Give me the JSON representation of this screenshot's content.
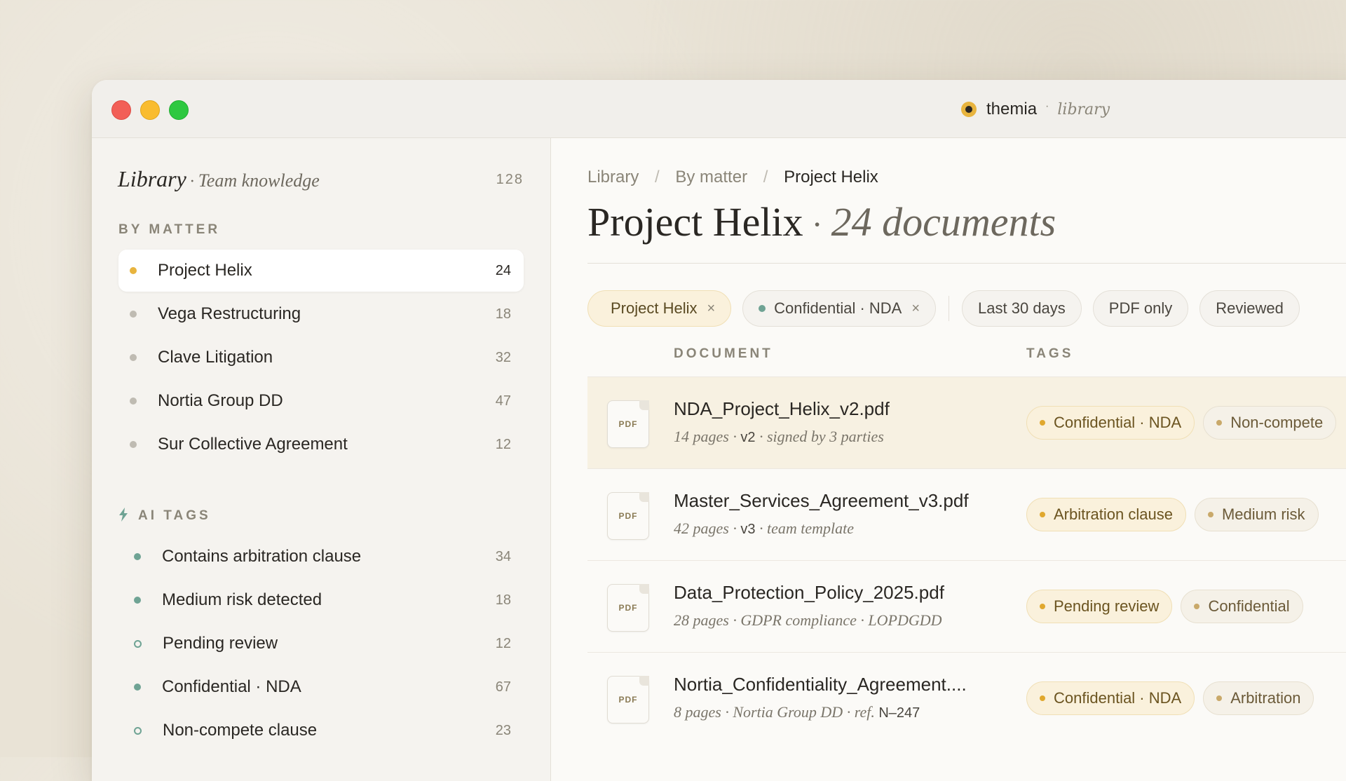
{
  "window": {
    "brand": "themia",
    "brand_separator": "·",
    "brand_sub": "library"
  },
  "sidebar": {
    "title": "Library",
    "title_separator": "·",
    "subtitle": "Team knowledge",
    "total_count": "128",
    "matter_section": "BY MATTER",
    "matters": [
      {
        "label": "Project Helix",
        "count": "24",
        "active": true
      },
      {
        "label": "Vega Restructuring",
        "count": "18"
      },
      {
        "label": "Clave Litigation",
        "count": "32"
      },
      {
        "label": "Nortia Group DD",
        "count": "47"
      },
      {
        "label": "Sur Collective Agreement",
        "count": "12"
      }
    ],
    "ai_section": "AI TAGS",
    "ai_tags": [
      {
        "label": "Contains arbitration clause",
        "count": "34"
      },
      {
        "label": "Medium risk detected",
        "count": "18"
      },
      {
        "label": "Pending review",
        "count": "12"
      },
      {
        "label": "Confidential · NDA",
        "count": "67"
      },
      {
        "label": "Non-compete clause",
        "count": "23"
      }
    ]
  },
  "main": {
    "breadcrumb": [
      "Library",
      "By matter",
      "Project Helix"
    ],
    "breadcrumb_separator": "/",
    "title": "Project Helix",
    "title_separator": "·",
    "title_count": "24 documents",
    "filters": [
      {
        "label": "Project Helix",
        "remove": "×"
      },
      {
        "label": "Confidential · NDA",
        "remove": "×"
      },
      {
        "label": "Last 30 days"
      },
      {
        "label": "PDF only"
      },
      {
        "label": "Reviewed"
      }
    ],
    "columns": {
      "document": "DOCUMENT",
      "tags": "TAGS"
    },
    "file_icon_label": "PDF",
    "documents": [
      {
        "name": "NDA_Project_Helix_v2.pdf",
        "meta_a": "14 pages ·",
        "meta_b": "v2",
        "meta_c": "· signed by 3 parties",
        "tags": [
          "Confidential · NDA",
          "Non-compete"
        ]
      },
      {
        "name": "Master_Services_Agreement_v3.pdf",
        "meta_a": "42 pages ·",
        "meta_b": "v3",
        "meta_c": "· team template",
        "tags": [
          "Arbitration clause",
          "Medium risk"
        ]
      },
      {
        "name": "Data_Protection_Policy_2025.pdf",
        "meta_a": "28 pages · GDPR compliance · LOPDGDD",
        "meta_b": "",
        "meta_c": "",
        "tags": [
          "Pending review",
          "Confidential"
        ]
      },
      {
        "name": "Nortia_Confidentiality_Agreement....",
        "meta_a": "8 pages · Nortia Group DD · ref.",
        "meta_b": "N–247",
        "meta_c": "",
        "tags": [
          "Confidential · NDA",
          "Arbitration"
        ]
      }
    ]
  }
}
